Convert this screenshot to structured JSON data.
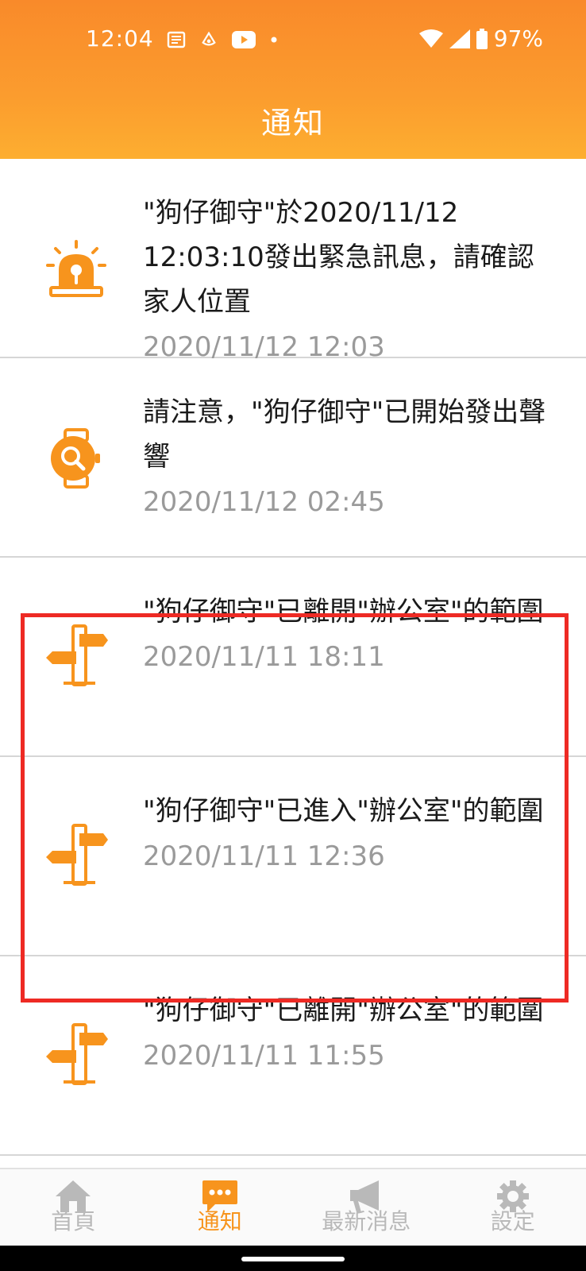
{
  "status_bar": {
    "time": "12:04",
    "battery": "97%",
    "icons_left": [
      "news-icon",
      "app-icon",
      "youtube-icon",
      "dot-icon"
    ],
    "icons_right": [
      "wifi-icon",
      "signal-icon",
      "battery-icon"
    ]
  },
  "header": {
    "title": "通知"
  },
  "notifications": [
    {
      "icon": "alarm-siren-icon",
      "message": "\"狗仔御守\"於2020/11/12 12:03:10發出緊急訊息，請確認家人位置",
      "time": "2020/11/12 12:03"
    },
    {
      "icon": "watch-search-icon",
      "message": "請注意，\"狗仔御守\"已開始發出聲響",
      "time": "2020/11/12 02:45"
    },
    {
      "icon": "signpost-icon",
      "message": "\"狗仔御守\"已離開\"辦公室\"的範圍",
      "time": "2020/11/11 18:11"
    },
    {
      "icon": "signpost-icon",
      "message": "\"狗仔御守\"已進入\"辦公室\"的範圍",
      "time": "2020/11/11 12:36"
    },
    {
      "icon": "signpost-icon",
      "message": "\"狗仔御守\"已離開\"辦公室\"的範圍",
      "time": "2020/11/11 11:55"
    }
  ],
  "bottom_nav": [
    {
      "label": "首頁",
      "icon": "home-icon",
      "active": false
    },
    {
      "label": "通知",
      "icon": "chat-icon",
      "active": true
    },
    {
      "label": "最新消息",
      "icon": "megaphone-icon",
      "active": false
    },
    {
      "label": "設定",
      "icon": "gear-icon",
      "active": false
    }
  ],
  "colors": {
    "brand_orange": "#f7941d",
    "highlight_red": "#ee2a24",
    "inactive_gray": "#b9b9b9"
  }
}
